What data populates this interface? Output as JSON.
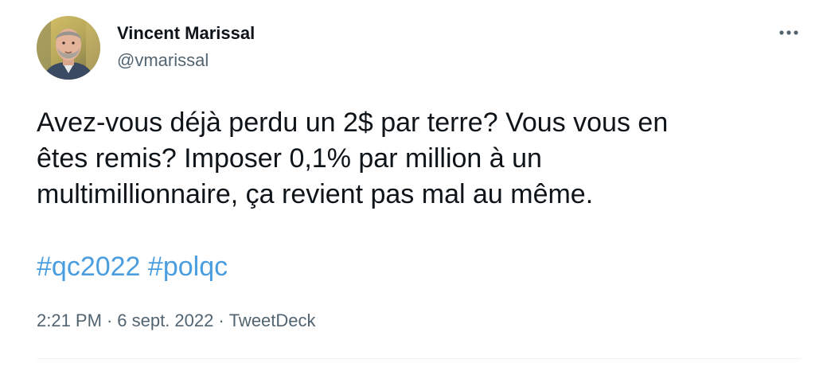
{
  "author": {
    "display_name": "Vincent Marissal",
    "handle": "@vmarissal",
    "avatar_icon": "profile-photo"
  },
  "tweet": {
    "lines": [
      "Avez-vous déjà perdu un 2$ par terre? Vous vous en",
      "êtes remis? Imposer 0,1% par million à un",
      "multimillionnaire, ça revient pas mal au même."
    ],
    "hashtags": [
      "#qc2022",
      "#polqc"
    ]
  },
  "meta": {
    "time": "2:21 PM",
    "date": "6 sept. 2022",
    "source": "TweetDeck",
    "separator": "·"
  },
  "more_icon": "more-horizontal-icon",
  "colors": {
    "text": "#0f1419",
    "secondary": "#536471",
    "link": "#4a9ee0"
  }
}
